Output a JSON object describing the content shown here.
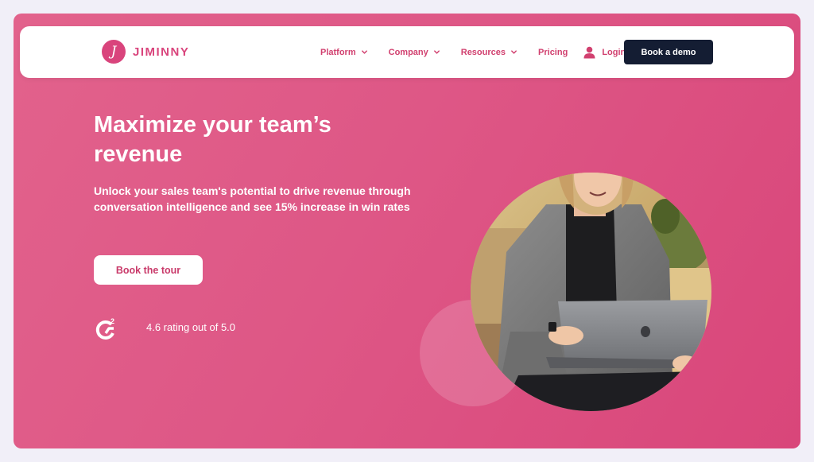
{
  "brand": {
    "name": "Jiminny",
    "mark": "J",
    "color": "#d9447c"
  },
  "nav": {
    "items": [
      {
        "label": "Platform",
        "has_dropdown": true
      },
      {
        "label": "Company",
        "has_dropdown": true
      },
      {
        "label": "Resources",
        "has_dropdown": true
      },
      {
        "label": "Pricing",
        "has_dropdown": false
      }
    ],
    "login_label": "Login",
    "cta_label": "Book a demo",
    "cta_color": "#141d33"
  },
  "hero": {
    "title": "Maximize your team’s revenue",
    "subtitle": "Unlock your sales team's potential to drive revenue through conversation intelligence and see 15% increase in win rates",
    "cta_label": "Book the tour",
    "rating_text": "4.6 rating out of 5.0",
    "rating_icon": "g2-logo-icon",
    "background_color": "#de5786"
  }
}
